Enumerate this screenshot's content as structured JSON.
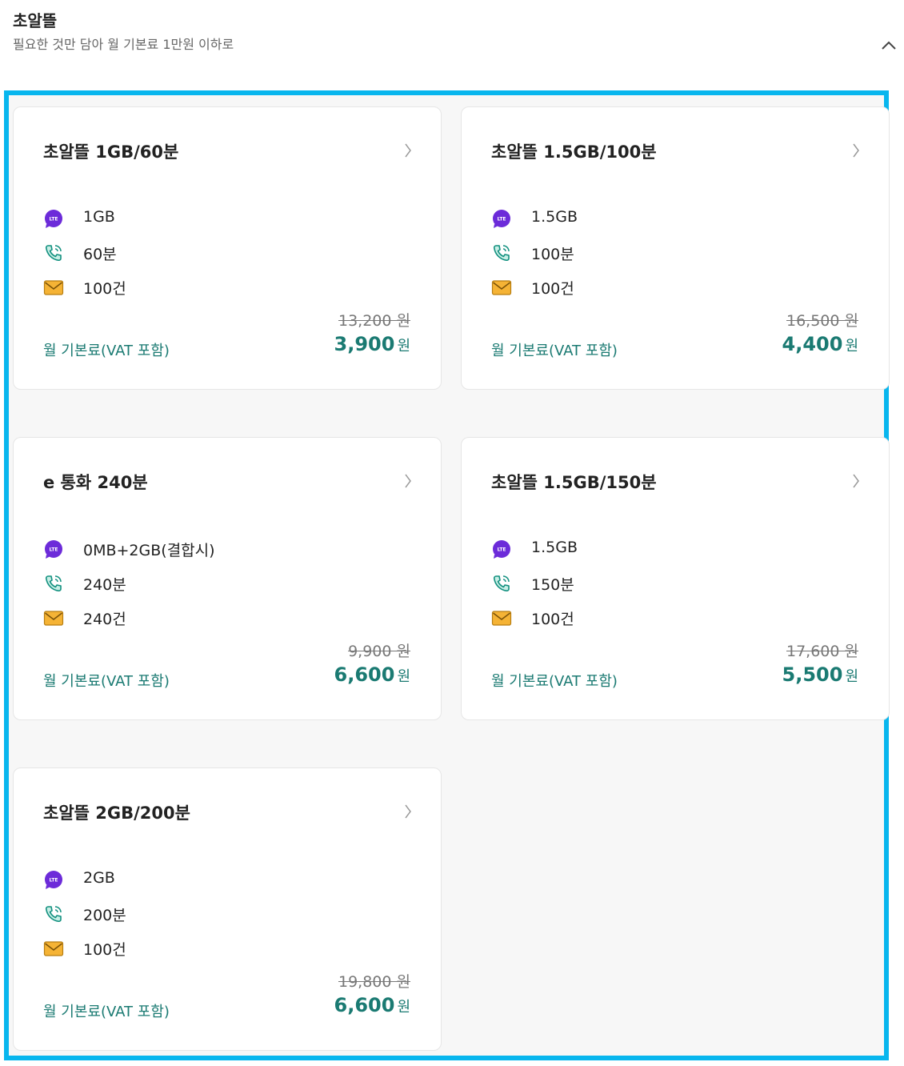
{
  "header": {
    "title": "초알뜰",
    "subtitle": "필요한 것만 담아 월 기본료 1만원 이하로"
  },
  "plans": [
    {
      "name": "초알뜰 1GB/60분",
      "data": "1GB",
      "voice": "60분",
      "sms": "100건",
      "fee_label": "월 기본료(VAT 포함)",
      "original": "13,200 원",
      "price": "3,900",
      "unit": "원"
    },
    {
      "name": "초알뜰 1.5GB/100분",
      "data": "1.5GB",
      "voice": "100분",
      "sms": "100건",
      "fee_label": "월 기본료(VAT 포함)",
      "original": "16,500 원",
      "price": "4,400",
      "unit": "원"
    },
    {
      "name": "e 통화 240분",
      "data": "0MB+2GB(결합시)",
      "voice": "240분",
      "sms": "240건",
      "fee_label": "월 기본료(VAT 포함)",
      "original": "9,900 원",
      "price": "6,600",
      "unit": "원"
    },
    {
      "name": "초알뜰 1.5GB/150분",
      "data": "1.5GB",
      "voice": "150분",
      "sms": "100건",
      "fee_label": "월 기본료(VAT 포함)",
      "original": "17,600 원",
      "price": "5,500",
      "unit": "원"
    },
    {
      "name": "초알뜰 2GB/200분",
      "data": "2GB",
      "voice": "200분",
      "sms": "100건",
      "fee_label": "월 기본료(VAT 포함)",
      "original": "19,800 원",
      "price": "6,600",
      "unit": "원"
    }
  ],
  "icons": {
    "data": "lte-data-icon",
    "voice": "phone-icon",
    "sms": "envelope-icon",
    "chevron": "chevron-right-icon",
    "collapse": "chevron-up-icon"
  },
  "colors": {
    "accent": "#1a7a72",
    "highlight_border": "#08b6ee",
    "lte_icon": "#6c2bd9",
    "mail_icon": "#f5b335",
    "phone_icon": "#12907f"
  }
}
